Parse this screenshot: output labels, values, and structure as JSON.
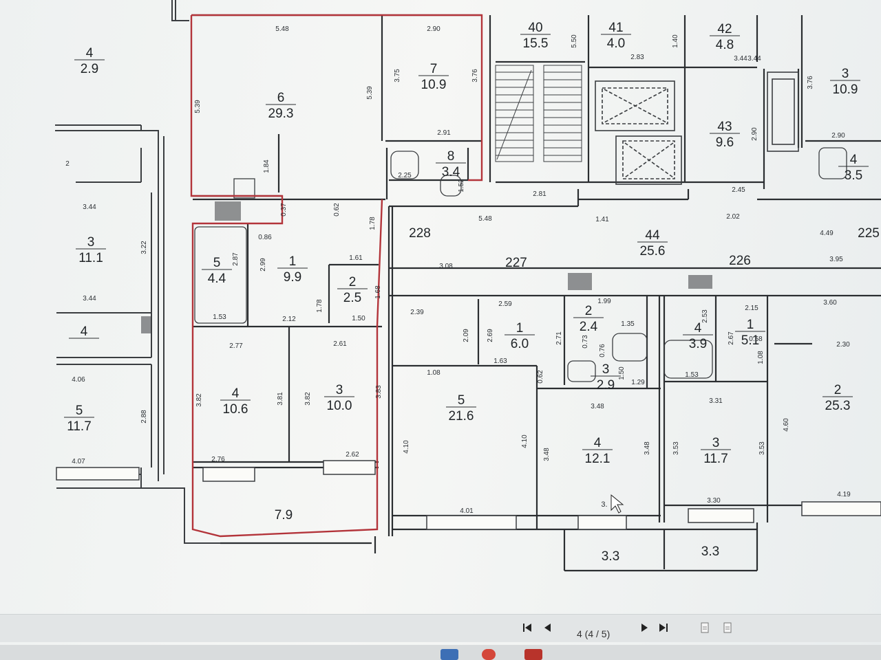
{
  "rooms": [
    {
      "id": "r-left-4",
      "num": "4",
      "area": "2.9"
    },
    {
      "id": "r-left-3",
      "num": "3",
      "area": "11.1"
    },
    {
      "id": "r-left-4b",
      "num": "4",
      "area": ""
    },
    {
      "id": "r-left-5",
      "num": "5",
      "area": "11.7"
    },
    {
      "id": "r-6",
      "num": "6",
      "area": "29.3"
    },
    {
      "id": "r-7",
      "num": "7",
      "area": "10.9"
    },
    {
      "id": "r-8",
      "num": "8",
      "area": "3.4"
    },
    {
      "id": "r-5a",
      "num": "5",
      "area": "4.4"
    },
    {
      "id": "r-1a",
      "num": "1",
      "area": "9.9"
    },
    {
      "id": "r-2a",
      "num": "2",
      "area": "2.5"
    },
    {
      "id": "r-4a",
      "num": "4",
      "area": "10.6"
    },
    {
      "id": "r-3a",
      "num": "3",
      "area": "10.0"
    },
    {
      "id": "r-40",
      "num": "40",
      "area": "15.5"
    },
    {
      "id": "r-41",
      "num": "41",
      "area": "4.0"
    },
    {
      "id": "r-42",
      "num": "42",
      "area": "4.8"
    },
    {
      "id": "r-43",
      "num": "43",
      "area": "9.6"
    },
    {
      "id": "r-3r",
      "num": "3",
      "area": "10.9"
    },
    {
      "id": "r-4r",
      "num": "4",
      "area": "3.5"
    },
    {
      "id": "r-44",
      "num": "44",
      "area": "25.6"
    },
    {
      "id": "r-1b",
      "num": "1",
      "area": "6.0"
    },
    {
      "id": "r-2b",
      "num": "2",
      "area": "2.4"
    },
    {
      "id": "r-3b",
      "num": "3",
      "area": "2.9"
    },
    {
      "id": "r-5b",
      "num": "5",
      "area": "21.6"
    },
    {
      "id": "r-4c",
      "num": "4",
      "area": "12.1"
    },
    {
      "id": "r-4d",
      "num": "4",
      "area": "3.9"
    },
    {
      "id": "r-1c",
      "num": "1",
      "area": "5.1"
    },
    {
      "id": "r-3c",
      "num": "3",
      "area": "11.7"
    },
    {
      "id": "r-2c",
      "num": "2",
      "area": "25.3"
    }
  ],
  "apartment_labels": [
    "228",
    "227",
    "226",
    "225"
  ],
  "balconies": [
    "7.9",
    "3.3",
    "3.3"
  ],
  "dims": [
    "5.48",
    "2.90",
    "5.39",
    "5.39",
    "3.75",
    "3.76",
    "2.91",
    "1.84",
    "0.37",
    "0.62",
    "1.78",
    "2.25",
    "1.52",
    "0.86",
    "2.87",
    "2.99",
    "1.61",
    "1.78",
    "1.68",
    "1.53",
    "2.12",
    "1.50",
    "2.77",
    "2.61",
    "3.82",
    "3.81",
    "3.82",
    "3.83",
    "2.76",
    "2.62",
    "5.50",
    "1.40",
    "2.83",
    "3.44",
    "3.76",
    "2.90",
    "2.81",
    "2.45",
    "2.02",
    "1.41",
    "5.48",
    "3.08",
    "4.49",
    "3.95",
    "2.59",
    "2.39",
    "2.09",
    "2.69",
    "1.63",
    "1.08",
    "0.62",
    "2.71",
    "1.99",
    "1.35",
    "0.73",
    "0.76",
    "1.50",
    "1.29",
    "2.53",
    "2.15",
    "2.67",
    "0.58",
    "1.08",
    "3.60",
    "2.30",
    "1.53",
    "4.10",
    "4.10",
    "3.48",
    "3.48",
    "3.48",
    "3.31",
    "3.53",
    "3.53",
    "4.60",
    "4.01",
    "3.30",
    "4.19",
    "3.44",
    "3.22",
    "3.44",
    "4.06",
    "2.88",
    "4.07",
    "3.44",
    "2.90",
    "2"
  ],
  "cursor_value": "3.",
  "toolbar": {
    "page_indicator": "4 (4 / 5)",
    "first_icon": "skip-first-icon",
    "prev_icon": "prev-page-icon",
    "next_icon": "next-page-icon",
    "last_icon": "skip-last-icon",
    "export_icon": "document-export-icon",
    "save_icon": "document-save-icon"
  },
  "colors": {
    "wall": "#2a2d30",
    "highlight": "#b3343a",
    "background": "#f1f3f2"
  }
}
